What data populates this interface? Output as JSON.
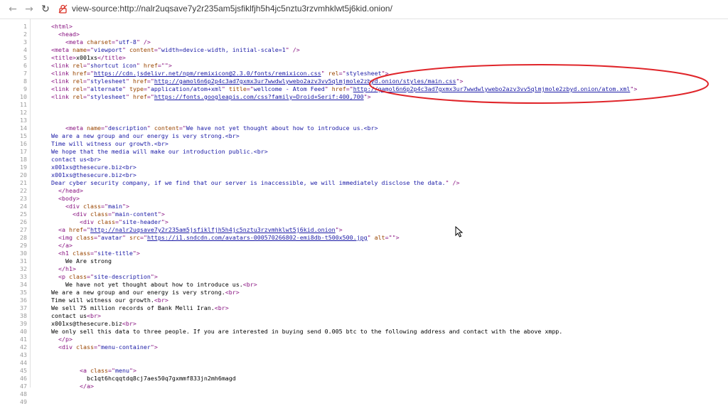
{
  "browser": {
    "url": "view-source:http://nalr2uqsave7y2r235am5jsfiklfjh5h4jc5nztu3rzvmhklwt5j6kid.onion/",
    "back_icon": "arrow-left-icon",
    "forward_icon": "arrow-right-icon",
    "reload_icon": "reload-icon",
    "site_icon": "insecure-lock-icon",
    "ellipse_color": "#e0252a"
  },
  "source_lines": [
    {
      "n": "1",
      "indent": 0,
      "parts": [
        {
          "t": "tag",
          "v": "<html>"
        }
      ]
    },
    {
      "n": "2",
      "indent": 2,
      "parts": [
        {
          "t": "tag",
          "v": "<head>"
        }
      ]
    },
    {
      "n": "3",
      "indent": 4,
      "parts": [
        {
          "t": "tag",
          "v": "<meta "
        },
        {
          "t": "an",
          "v": "charset"
        },
        {
          "t": "tag",
          "v": "=\""
        },
        {
          "t": "av",
          "v": "utf-8"
        },
        {
          "t": "tag",
          "v": "\" />"
        }
      ]
    },
    {
      "n": "4",
      "indent": 0,
      "parts": [
        {
          "t": "tag",
          "v": "<meta "
        },
        {
          "t": "an",
          "v": "name"
        },
        {
          "t": "tag",
          "v": "=\""
        },
        {
          "t": "av",
          "v": "viewport"
        },
        {
          "t": "tag",
          "v": "\" "
        },
        {
          "t": "an",
          "v": "content"
        },
        {
          "t": "tag",
          "v": "=\""
        },
        {
          "t": "av",
          "v": "width=device-width, initial-scale=1"
        },
        {
          "t": "tag",
          "v": "\" />"
        }
      ]
    },
    {
      "n": "5",
      "indent": 0,
      "parts": [
        {
          "t": "tag",
          "v": "<title>"
        },
        {
          "t": "txt",
          "v": "x001xs"
        },
        {
          "t": "tag",
          "v": "</title>"
        }
      ]
    },
    {
      "n": "6",
      "indent": 0,
      "parts": [
        {
          "t": "tag",
          "v": "<link "
        },
        {
          "t": "an",
          "v": "rel"
        },
        {
          "t": "tag",
          "v": "=\""
        },
        {
          "t": "av",
          "v": "shortcut icon"
        },
        {
          "t": "tag",
          "v": "\" "
        },
        {
          "t": "an",
          "v": "href"
        },
        {
          "t": "tag",
          "v": "=\"\">"
        }
      ]
    },
    {
      "n": "7",
      "indent": 0,
      "parts": [
        {
          "t": "tag",
          "v": "<link "
        },
        {
          "t": "an",
          "v": "href"
        },
        {
          "t": "tag",
          "v": "=\""
        },
        {
          "t": "lnk",
          "v": "https://cdn.jsdelivr.net/npm/remixicon@2.3.0/fonts/remixicon.css"
        },
        {
          "t": "tag",
          "v": "\" "
        },
        {
          "t": "an",
          "v": "rel"
        },
        {
          "t": "tag",
          "v": "=\""
        },
        {
          "t": "av",
          "v": "stylesheet"
        },
        {
          "t": "tag",
          "v": "\">"
        }
      ]
    },
    {
      "n": "8",
      "indent": 0,
      "parts": [
        {
          "t": "tag",
          "v": "<link "
        },
        {
          "t": "an",
          "v": "rel"
        },
        {
          "t": "tag",
          "v": "=\""
        },
        {
          "t": "av",
          "v": "stylesheet"
        },
        {
          "t": "tag",
          "v": "\" "
        },
        {
          "t": "an",
          "v": "href"
        },
        {
          "t": "tag",
          "v": "=\""
        },
        {
          "t": "lnk",
          "v": "http://gamol6n6p2p4c3ad7gxmx3ur7wwdwlywebo2azv3vv5qlmjmole2zbyd.onion/styles/main.css"
        },
        {
          "t": "tag",
          "v": "\">"
        }
      ]
    },
    {
      "n": "9",
      "indent": 0,
      "parts": [
        {
          "t": "tag",
          "v": "<link "
        },
        {
          "t": "an",
          "v": "rel"
        },
        {
          "t": "tag",
          "v": "=\""
        },
        {
          "t": "av",
          "v": "alternate"
        },
        {
          "t": "tag",
          "v": "\" "
        },
        {
          "t": "an",
          "v": "type"
        },
        {
          "t": "tag",
          "v": "=\""
        },
        {
          "t": "av",
          "v": "application/atom+xml"
        },
        {
          "t": "tag",
          "v": "\" "
        },
        {
          "t": "an",
          "v": "title"
        },
        {
          "t": "tag",
          "v": "=\""
        },
        {
          "t": "av",
          "v": "wellcome - Atom Feed"
        },
        {
          "t": "tag",
          "v": "\" "
        },
        {
          "t": "an",
          "v": "href"
        },
        {
          "t": "tag",
          "v": "=\""
        },
        {
          "t": "lnk",
          "v": "http://gamol6n6p2p4c3ad7gxmx3ur7wwdwlywebo2azv3vv5qlmjmole2zbyd.onion/atom.xml"
        },
        {
          "t": "tag",
          "v": "\">"
        }
      ]
    },
    {
      "n": "10",
      "indent": 0,
      "parts": [
        {
          "t": "tag",
          "v": "<link "
        },
        {
          "t": "an",
          "v": "rel"
        },
        {
          "t": "tag",
          "v": "=\""
        },
        {
          "t": "av",
          "v": "stylesheet"
        },
        {
          "t": "tag",
          "v": "\" "
        },
        {
          "t": "an",
          "v": "href"
        },
        {
          "t": "tag",
          "v": "=\""
        },
        {
          "t": "lnk",
          "v": "https://fonts.googleapis.com/css?family=Droid+Serif:400,700"
        },
        {
          "t": "tag",
          "v": "\">"
        }
      ]
    },
    {
      "n": "11",
      "indent": 0,
      "parts": []
    },
    {
      "n": "12",
      "indent": 0,
      "parts": []
    },
    {
      "n": "13",
      "indent": 0,
      "parts": []
    },
    {
      "n": "14",
      "indent": 4,
      "parts": [
        {
          "t": "tag",
          "v": "<meta "
        },
        {
          "t": "an",
          "v": "name"
        },
        {
          "t": "tag",
          "v": "=\""
        },
        {
          "t": "av",
          "v": "description"
        },
        {
          "t": "tag",
          "v": "\" "
        },
        {
          "t": "an",
          "v": "content"
        },
        {
          "t": "tag",
          "v": "=\""
        },
        {
          "t": "av",
          "v": "We have not yet thought about how to introduce us.<br>"
        }
      ]
    },
    {
      "n": "15",
      "indent": 0,
      "parts": [
        {
          "t": "av",
          "v": "We are a new group and our energy is very strong.<br>"
        }
      ]
    },
    {
      "n": "16",
      "indent": 0,
      "parts": [
        {
          "t": "av",
          "v": "Time will witness our growth.<br>"
        }
      ]
    },
    {
      "n": "17",
      "indent": 0,
      "parts": [
        {
          "t": "av",
          "v": "We hope that the media will make our introduction public.<br>"
        }
      ]
    },
    {
      "n": "18",
      "indent": 0,
      "parts": [
        {
          "t": "av",
          "v": "contact us<br>"
        }
      ]
    },
    {
      "n": "19",
      "indent": 0,
      "parts": [
        {
          "t": "av",
          "v": "x001xs@thesecure.biz<br>"
        }
      ]
    },
    {
      "n": "20",
      "indent": 0,
      "parts": [
        {
          "t": "av",
          "v": "x001xs@thesecure.biz<br>"
        }
      ]
    },
    {
      "n": "21",
      "indent": 0,
      "parts": [
        {
          "t": "av",
          "v": "Dear cyber security company, if we find that our server is inaccessible, we will immediately disclose the data."
        },
        {
          "t": "tag",
          "v": "\" />"
        }
      ]
    },
    {
      "n": "22",
      "indent": 2,
      "parts": [
        {
          "t": "tag",
          "v": "</head>"
        }
      ]
    },
    {
      "n": "23",
      "indent": 2,
      "parts": [
        {
          "t": "tag",
          "v": "<body>"
        }
      ]
    },
    {
      "n": "24",
      "indent": 4,
      "parts": [
        {
          "t": "tag",
          "v": "<div "
        },
        {
          "t": "an",
          "v": "class"
        },
        {
          "t": "tag",
          "v": "=\""
        },
        {
          "t": "av",
          "v": "main"
        },
        {
          "t": "tag",
          "v": "\">"
        }
      ]
    },
    {
      "n": "25",
      "indent": 6,
      "parts": [
        {
          "t": "tag",
          "v": "<div "
        },
        {
          "t": "an",
          "v": "class"
        },
        {
          "t": "tag",
          "v": "=\""
        },
        {
          "t": "av",
          "v": "main-content"
        },
        {
          "t": "tag",
          "v": "\">"
        }
      ]
    },
    {
      "n": "26",
      "indent": 8,
      "parts": [
        {
          "t": "tag",
          "v": "<div "
        },
        {
          "t": "an",
          "v": "class"
        },
        {
          "t": "tag",
          "v": "=\""
        },
        {
          "t": "av",
          "v": "site-header"
        },
        {
          "t": "tag",
          "v": "\">"
        }
      ]
    },
    {
      "n": "27",
      "indent": 2,
      "parts": [
        {
          "t": "tag",
          "v": "<a "
        },
        {
          "t": "an",
          "v": "href"
        },
        {
          "t": "tag",
          "v": "=\""
        },
        {
          "t": "lnk",
          "v": "http://nalr2uqsave7y2r235am5jsfiklfjh5h4jc5nztu3rzvmhklwt5j6kid.onion"
        },
        {
          "t": "tag",
          "v": "\">"
        }
      ]
    },
    {
      "n": "28",
      "indent": 2,
      "parts": [
        {
          "t": "tag",
          "v": "<img "
        },
        {
          "t": "an",
          "v": "class"
        },
        {
          "t": "tag",
          "v": "=\""
        },
        {
          "t": "av",
          "v": "avatar"
        },
        {
          "t": "tag",
          "v": "\" "
        },
        {
          "t": "an",
          "v": "src"
        },
        {
          "t": "tag",
          "v": "=\""
        },
        {
          "t": "lnk",
          "v": "https://i1.sndcdn.com/avatars-000570266802-emi8db-t500x500.jpg"
        },
        {
          "t": "tag",
          "v": "\" "
        },
        {
          "t": "an",
          "v": "alt"
        },
        {
          "t": "tag",
          "v": "=\"\">"
        }
      ]
    },
    {
      "n": "29",
      "indent": 2,
      "parts": [
        {
          "t": "tag",
          "v": "</a>"
        }
      ]
    },
    {
      "n": "30",
      "indent": 2,
      "parts": [
        {
          "t": "tag",
          "v": "<h1 "
        },
        {
          "t": "an",
          "v": "class"
        },
        {
          "t": "tag",
          "v": "=\""
        },
        {
          "t": "av",
          "v": "site-title"
        },
        {
          "t": "tag",
          "v": "\">"
        }
      ]
    },
    {
      "n": "31",
      "indent": 4,
      "parts": [
        {
          "t": "txt",
          "v": "We Are strong"
        }
      ]
    },
    {
      "n": "32",
      "indent": 2,
      "parts": [
        {
          "t": "tag",
          "v": "</h1>"
        }
      ]
    },
    {
      "n": "33",
      "indent": 2,
      "parts": [
        {
          "t": "tag",
          "v": "<p "
        },
        {
          "t": "an",
          "v": "class"
        },
        {
          "t": "tag",
          "v": "=\""
        },
        {
          "t": "av",
          "v": "site-description"
        },
        {
          "t": "tag",
          "v": "\">"
        }
      ]
    },
    {
      "n": "34",
      "indent": 4,
      "parts": [
        {
          "t": "txt",
          "v": "We have not yet thought about how to introduce us."
        },
        {
          "t": "tag",
          "v": "<br>"
        }
      ]
    },
    {
      "n": "35",
      "indent": 0,
      "parts": [
        {
          "t": "txt",
          "v": "We are a new group and our energy is very strong."
        },
        {
          "t": "tag",
          "v": "<br>"
        }
      ]
    },
    {
      "n": "36",
      "indent": 0,
      "parts": [
        {
          "t": "txt",
          "v": "Time will witness our growth."
        },
        {
          "t": "tag",
          "v": "<br>"
        }
      ]
    },
    {
      "n": "37",
      "indent": 0,
      "parts": [
        {
          "t": "txt",
          "v": "We sell 75 million records of Bank Melli Iran."
        },
        {
          "t": "tag",
          "v": "<br>"
        }
      ]
    },
    {
      "n": "38",
      "indent": 0,
      "parts": [
        {
          "t": "txt",
          "v": "contact us"
        },
        {
          "t": "tag",
          "v": "<br>"
        }
      ]
    },
    {
      "n": "39",
      "indent": 0,
      "parts": [
        {
          "t": "txt",
          "v": "x001xs@thesecure.biz"
        },
        {
          "t": "tag",
          "v": "<br>"
        }
      ]
    },
    {
      "n": "40",
      "indent": 0,
      "parts": [
        {
          "t": "txt",
          "v": "We only sell this data to three people. If you are interested in buying send 0.005 btc to the following address and contact with the above xmpp."
        }
      ]
    },
    {
      "n": "41",
      "indent": 2,
      "parts": [
        {
          "t": "tag",
          "v": "</p>"
        }
      ]
    },
    {
      "n": "42",
      "indent": 2,
      "parts": [
        {
          "t": "tag",
          "v": "<div "
        },
        {
          "t": "an",
          "v": "class"
        },
        {
          "t": "tag",
          "v": "=\""
        },
        {
          "t": "av",
          "v": "menu-container"
        },
        {
          "t": "tag",
          "v": "\">"
        }
      ]
    },
    {
      "n": "43",
      "indent": 0,
      "parts": []
    },
    {
      "n": "44",
      "indent": 0,
      "parts": []
    },
    {
      "n": "45",
      "indent": 8,
      "parts": [
        {
          "t": "tag",
          "v": "<a "
        },
        {
          "t": "an",
          "v": "class"
        },
        {
          "t": "tag",
          "v": "=\""
        },
        {
          "t": "av",
          "v": "menu"
        },
        {
          "t": "tag",
          "v": "\">"
        }
      ]
    },
    {
      "n": "46",
      "indent": 10,
      "parts": [
        {
          "t": "txt",
          "v": "bc1qt6hcqqtdq8cj7aes50q7gxmmf833jn2mh6magd"
        }
      ]
    },
    {
      "n": "47",
      "indent": 8,
      "parts": [
        {
          "t": "tag",
          "v": "</a>"
        }
      ]
    },
    {
      "n": "48",
      "indent": 0,
      "parts": []
    },
    {
      "n": "49",
      "indent": 0,
      "parts": []
    }
  ]
}
